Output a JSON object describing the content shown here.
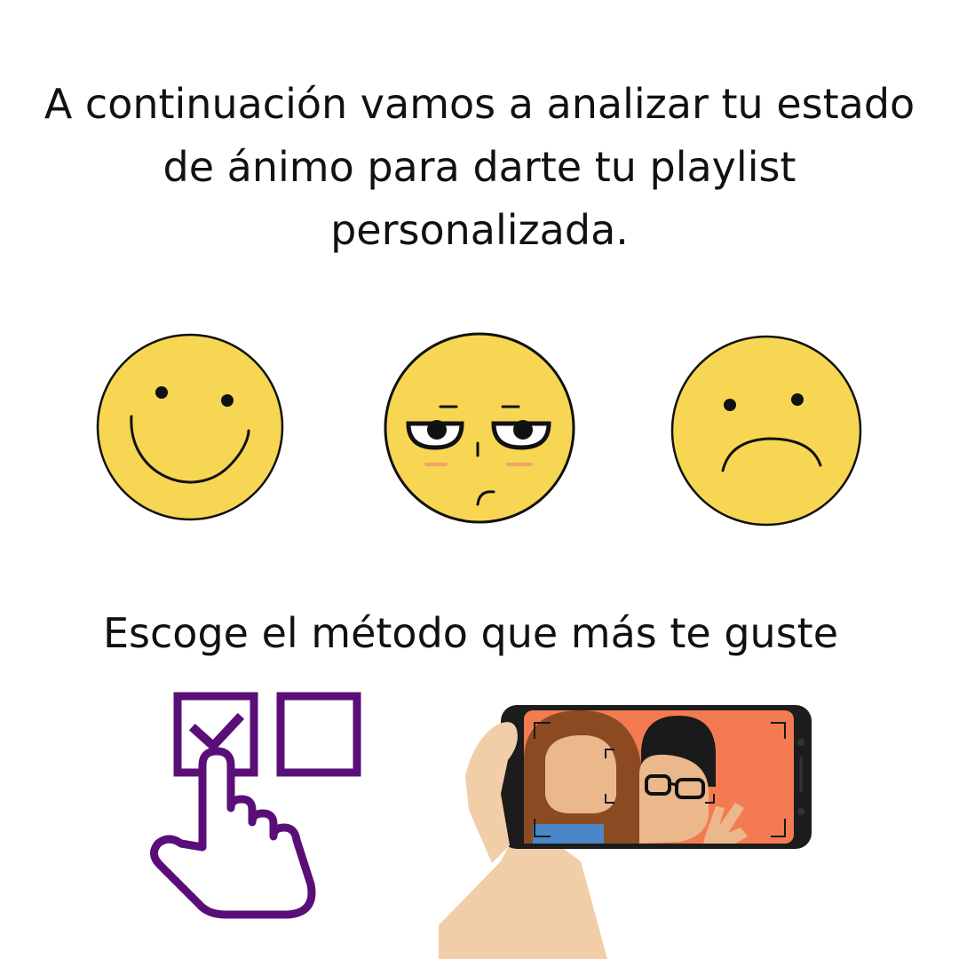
{
  "intro_text": "A continuación vamos a analizar tu estado de ánimo para darte tu playlist personalizada.",
  "method_prompt": "Escoge el método que más te guste",
  "moods": [
    {
      "icon": "happy-face-icon"
    },
    {
      "icon": "unimpressed-face-icon"
    },
    {
      "icon": "sad-face-icon"
    }
  ],
  "methods": [
    {
      "icon": "checkbox-hand-icon"
    },
    {
      "icon": "phone-selfie-icon"
    }
  ],
  "colors": {
    "face_yellow": "#F7D654",
    "outline": "#111111",
    "purple": "#5A0F78",
    "screen_orange": "#F47A52",
    "skin": "#F1CDA8"
  }
}
